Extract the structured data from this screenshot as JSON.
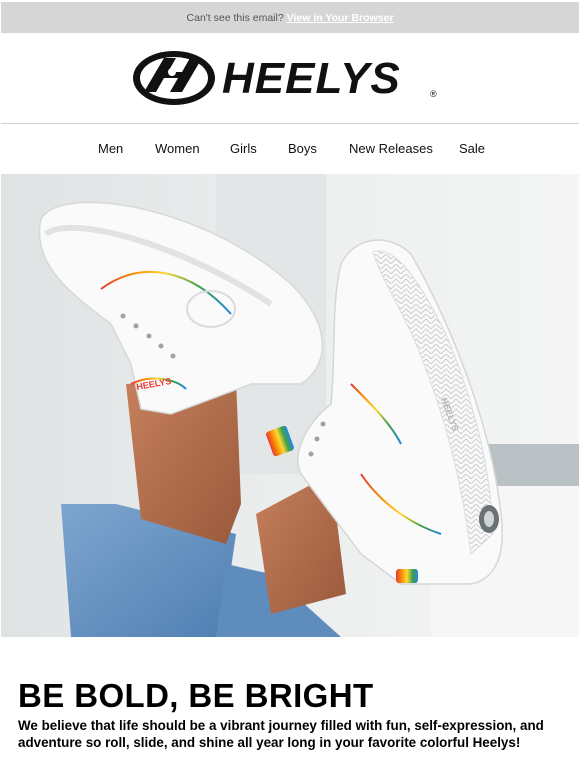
{
  "preheader": {
    "text": "Can't see this email?",
    "link_label": "View in Your Browser"
  },
  "brand": {
    "wordmark": "HEELYS",
    "registered": "®"
  },
  "nav": {
    "items": [
      {
        "label": "Men"
      },
      {
        "label": "Women"
      },
      {
        "label": "Girls"
      },
      {
        "label": "Boys"
      },
      {
        "label": "New Releases"
      },
      {
        "label": "Sale"
      }
    ]
  },
  "hero": {
    "shoe_tongue_text": "HEELYS",
    "shoe_heel_text": "HEELYS"
  },
  "content": {
    "headline": "BE BOLD, BE BRIGHT",
    "body": "We believe that life should be a vibrant journey filled with fun, self-expression, and adventure so roll, slide, and shine all year long in your favorite colorful Heelys!"
  },
  "colors": {
    "preheader_bg": "#d6d6d6",
    "link": "#ffffff",
    "text": "#000000",
    "divider": "#cfcfcf"
  }
}
